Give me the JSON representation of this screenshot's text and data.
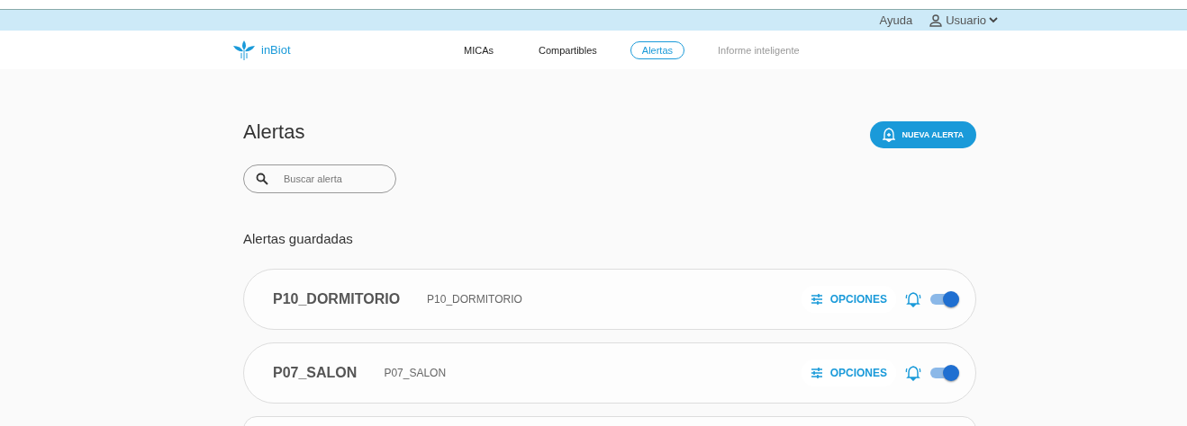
{
  "top_bar": {
    "help": "Ayuda",
    "user": "Usuario"
  },
  "nav": {
    "brand": "inBiot",
    "tabs": [
      {
        "label": "MICAs",
        "selected": false,
        "disabled": false
      },
      {
        "label": "Compartibles",
        "selected": false,
        "disabled": false
      },
      {
        "label": "Alertas",
        "selected": true,
        "disabled": false
      },
      {
        "label": "Informe inteligente",
        "selected": false,
        "disabled": true
      }
    ]
  },
  "page": {
    "title": "Alertas",
    "new_button": "NUEVA ALERTA",
    "search": {
      "placeholder": "Buscar alerta"
    },
    "section_title": "Alertas guardadas"
  },
  "alerts": [
    {
      "name": "P10_DORMITORIO",
      "device": "P10_DORMITORIO",
      "options": "OPCIONES",
      "on": true
    },
    {
      "name": "P07_SALON",
      "device": "P07_SALON",
      "options": "OPCIONES",
      "on": true
    }
  ]
}
